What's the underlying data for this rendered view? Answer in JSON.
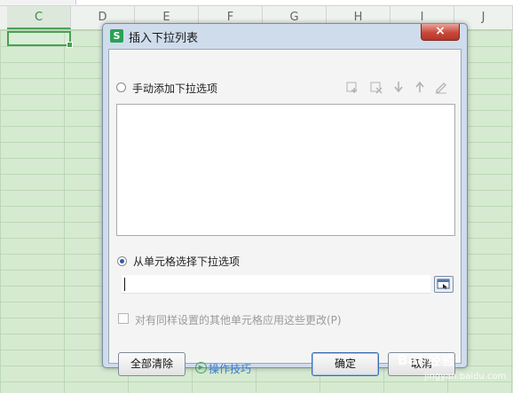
{
  "sheet": {
    "columns": [
      {
        "label": "C",
        "active": true
      },
      {
        "label": "D",
        "active": false
      },
      {
        "label": "E",
        "active": false
      },
      {
        "label": "F",
        "active": false
      },
      {
        "label": "G",
        "active": false
      },
      {
        "label": "H",
        "active": false
      },
      {
        "label": "I",
        "active": false
      },
      {
        "label": "J",
        "active": false
      }
    ]
  },
  "dialog": {
    "app_icon_letter": "S",
    "title": "插入下拉列表",
    "close_symbol": "×",
    "manual_option": {
      "label": "手动添加下拉选项",
      "selected": false
    },
    "toolbar_icons": [
      "add-item-icon",
      "delete-item-icon",
      "move-down-icon",
      "move-up-icon",
      "edit-item-icon"
    ],
    "list_items": [],
    "cell_option": {
      "label": "从单元格选择下拉选项",
      "selected": true
    },
    "cell_input_value": "",
    "apply_checkbox": {
      "label": "对有同样设置的其他单元格应用这些更改(P)",
      "checked": false,
      "enabled": false
    },
    "buttons": {
      "clear_all": "全部清除",
      "tips": "操作技巧",
      "ok": "确定",
      "cancel": "取消"
    }
  },
  "watermark": {
    "text": "Bai 经验",
    "sub": "jingyan.baidu.com"
  }
}
